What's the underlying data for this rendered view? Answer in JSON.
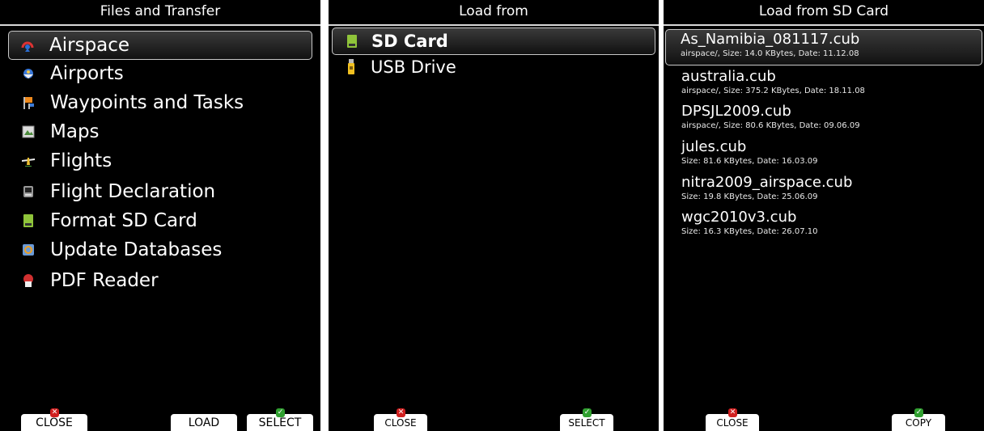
{
  "panel1": {
    "title": "Files and Transfer",
    "items": [
      {
        "label": "Airspace",
        "icon": "airspace-icon"
      },
      {
        "label": "Airports",
        "icon": "airport-icon"
      },
      {
        "label": "Waypoints and Tasks",
        "icon": "waypoint-flag-icon"
      },
      {
        "label": "Maps",
        "icon": "map-icon"
      },
      {
        "label": "Flights",
        "icon": "glider-icon"
      },
      {
        "label": "Flight Declaration",
        "icon": "declaration-icon"
      },
      {
        "label": "Format SD Card",
        "icon": "sd-card-icon"
      },
      {
        "label": "Update Databases",
        "icon": "database-icon"
      },
      {
        "label": "PDF Reader",
        "icon": "pdf-icon"
      }
    ],
    "buttons": {
      "close": "CLOSE",
      "load": "LOAD",
      "select": "SELECT"
    }
  },
  "panel2": {
    "title": "Load from",
    "items": [
      {
        "label": "SD Card",
        "icon": "sd-card-icon"
      },
      {
        "label": "USB Drive",
        "icon": "usb-drive-icon"
      }
    ],
    "buttons": {
      "close": "CLOSE",
      "select": "SELECT"
    }
  },
  "panel3": {
    "title": "Load from SD Card",
    "files": [
      {
        "name": "As_Namibia_081117.cub",
        "meta": "airspace/, Size: 14.0 KBytes, Date: 11.12.08"
      },
      {
        "name": "australia.cub",
        "meta": "airspace/, Size: 375.2 KBytes, Date: 18.11.08"
      },
      {
        "name": "DPSJL2009.cub",
        "meta": "airspace/, Size: 80.6 KBytes, Date: 09.06.09"
      },
      {
        "name": "jules.cub",
        "meta": "Size: 81.6 KBytes, Date: 16.03.09"
      },
      {
        "name": "nitra2009_airspace.cub",
        "meta": "Size: 19.8 KBytes, Date: 25.06.09"
      },
      {
        "name": "wgc2010v3.cub",
        "meta": "Size: 16.3 KBytes, Date: 26.07.10"
      }
    ],
    "buttons": {
      "close": "CLOSE",
      "copy": "COPY"
    }
  },
  "colors": {
    "background": "#000000",
    "text": "#ffffff",
    "close_badge": "#d02020",
    "ok_badge": "#30a030"
  }
}
